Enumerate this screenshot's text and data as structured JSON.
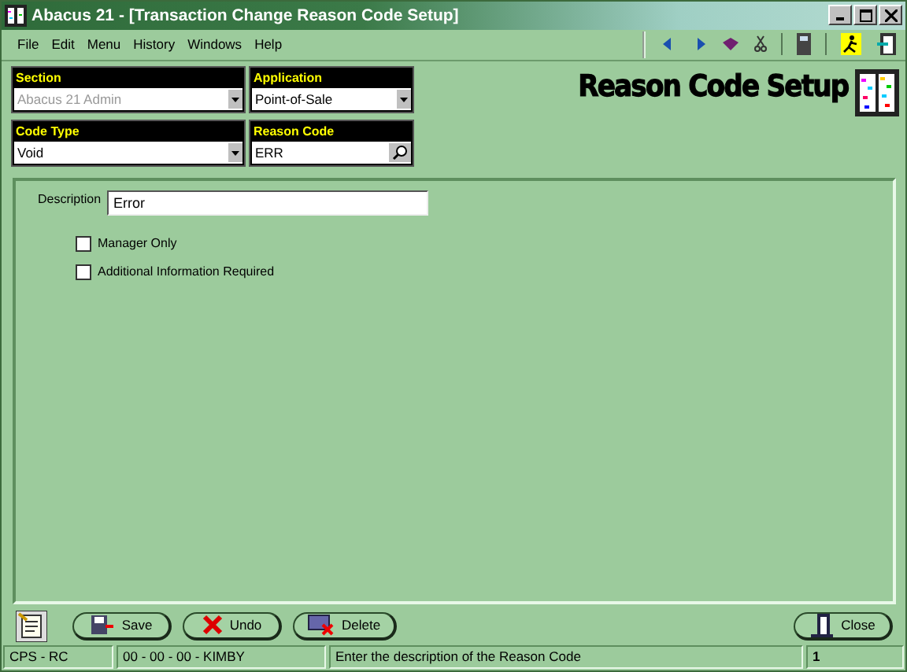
{
  "window": {
    "title": "Abacus 21 - [Transaction Change Reason Code Setup]"
  },
  "menu": [
    "File",
    "Edit",
    "Menu",
    "History",
    "Windows",
    "Help"
  ],
  "header_fields": [
    {
      "label": "Section",
      "value": "Abacus 21 Admin",
      "kind": "dropdown",
      "disabled": true
    },
    {
      "label": "Application",
      "value": "Point-of-Sale",
      "kind": "dropdown",
      "disabled": false
    },
    {
      "label": "Code Type",
      "value": "Void",
      "kind": "dropdown",
      "disabled": false
    },
    {
      "label": "Reason Code",
      "value": "ERR",
      "kind": "search",
      "disabled": false
    }
  ],
  "page_title": "Reason Code Setup",
  "description": {
    "label": "Description",
    "value": "Error"
  },
  "checkboxes": [
    {
      "label": "Manager Only",
      "checked": false
    },
    {
      "label": "Additional Information Required",
      "checked": false
    }
  ],
  "buttons": [
    {
      "label": "Save",
      "kind": "save"
    },
    {
      "label": "Undo",
      "kind": "undo"
    },
    {
      "label": "Delete",
      "kind": "delete"
    }
  ],
  "close_button": {
    "label": "Close"
  },
  "status_bar": [
    "CPS - RC",
    "00 - 00 - 00 - KIMBY",
    "Enter the description of the Reason Code",
    "1"
  ]
}
